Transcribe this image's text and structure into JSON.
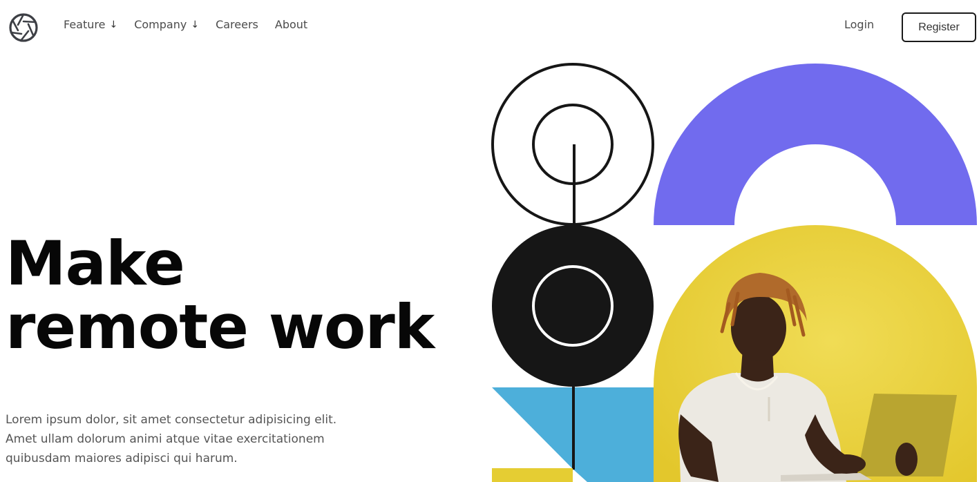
{
  "header": {
    "logo_icon": "aperture-logo-icon",
    "nav": [
      {
        "label": "Feature",
        "has_dropdown": true,
        "dropdown_icon": "arrow-down-icon"
      },
      {
        "label": "Company",
        "has_dropdown": true,
        "dropdown_icon": "arrow-down-icon"
      },
      {
        "label": "Careers",
        "has_dropdown": false
      },
      {
        "label": "About",
        "has_dropdown": false
      }
    ],
    "login_label": "Login",
    "register_label": "Register"
  },
  "hero": {
    "title_line1": "Make",
    "title_line2": "remote work",
    "body_line1": "Lorem ipsum dolor, sit amet consectetur adipisicing elit.",
    "body_line2": "Amet ullam dolorum animi atque vitae exercitationem",
    "body_line3": "quibusdam maiores adipisci qui harum."
  },
  "colors": {
    "purple_arch": "#716BEE",
    "yellow": "#E5CD33",
    "blue_triangle": "#4DAFDA",
    "black_circle": "#161616",
    "text_dark": "#070707",
    "text_muted": "#555555"
  }
}
